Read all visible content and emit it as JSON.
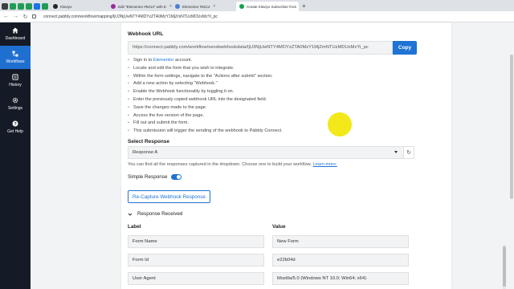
{
  "browser": {
    "tabs": [
      {
        "label": "Klaviyo",
        "active": false,
        "color": "#222222"
      },
      {
        "label": "Edit \"Elementor #6214\" with E",
        "active": false,
        "color": "#9b2c9b"
      },
      {
        "label": "Elementor #6214",
        "active": false,
        "color": "#4a7fd4"
      },
      {
        "label": "Create Klaviyo Subscriber from",
        "active": true,
        "color": "#16a34a"
      }
    ],
    "new_tab": "+",
    "url": "connect.pabbly.com/workflow/mapping/IjU3NjUwNTY4MDYzZTA0MzY1MjZmNTUzMDUxMzYi_pc"
  },
  "sidebar": {
    "items": [
      {
        "label": "Dashboard",
        "icon": "home-icon",
        "active": false
      },
      {
        "label": "Workflows",
        "icon": "workflow-icon",
        "active": true
      },
      {
        "label": "History",
        "icon": "history-icon",
        "active": false
      },
      {
        "label": "Settings",
        "icon": "gear-icon",
        "active": false
      },
      {
        "label": "Get Help",
        "icon": "help-icon",
        "active": false
      }
    ]
  },
  "webhook": {
    "title": "Webhook URL",
    "url": "https://connect.pabbly.com/workflow/sendwebhookdata/IjU3NjUwNTY4MDYzZTA0MzY1MjZmNTUzMDUxMzYi_pc",
    "copy_label": "Copy"
  },
  "steps": [
    {
      "pre": "Sign in to ",
      "link": "Elementor",
      "post": " account."
    },
    {
      "pre": "Locate and edit the form that you wish to integrate.",
      "link": "",
      "post": ""
    },
    {
      "pre": "Within the form settings, navigate to the \"Actions after submit\" section.",
      "link": "",
      "post": ""
    },
    {
      "pre": "Add a new action by selecting \"Webhook.\"",
      "link": "",
      "post": ""
    },
    {
      "pre": "Enable the Webhook functionality by toggling it on.",
      "link": "",
      "post": ""
    },
    {
      "pre": "Enter the previously copied webhook URL into the designated field.",
      "link": "",
      "post": ""
    },
    {
      "pre": "Save the changes made to the page.",
      "link": "",
      "post": ""
    },
    {
      "pre": "Access the live version of the page.",
      "link": "",
      "post": ""
    },
    {
      "pre": "Fill out and submit the form.",
      "link": "",
      "post": ""
    },
    {
      "pre": "This submission will trigger the sending of the webhook to Pabbly Connect.",
      "link": "",
      "post": ""
    }
  ],
  "select_response": {
    "label": "Select Response",
    "value": "Response A",
    "helper_text": "You can find all the responses captured in the dropdown. Choose one to build your workflow.",
    "helper_link": "Learn more."
  },
  "simple_response": {
    "label": "Simple Response",
    "enabled": true
  },
  "recapture_label": "Re-Capture Webhook Response",
  "response_received": {
    "label": "Response Received",
    "col_label": "Label",
    "col_value": "Value",
    "rows": [
      {
        "label": "Form Name",
        "value": "New Form"
      },
      {
        "label": "Form Id",
        "value": "e22b04d"
      },
      {
        "label": "User Agent",
        "value": "Mozilla/5.0 (Windows NT 10.0; Win64; x64)"
      }
    ]
  },
  "colors": {
    "accent": "#1e73d4",
    "sidebar_bg": "#151b26",
    "sidebar_active": "#1f6fd1"
  }
}
